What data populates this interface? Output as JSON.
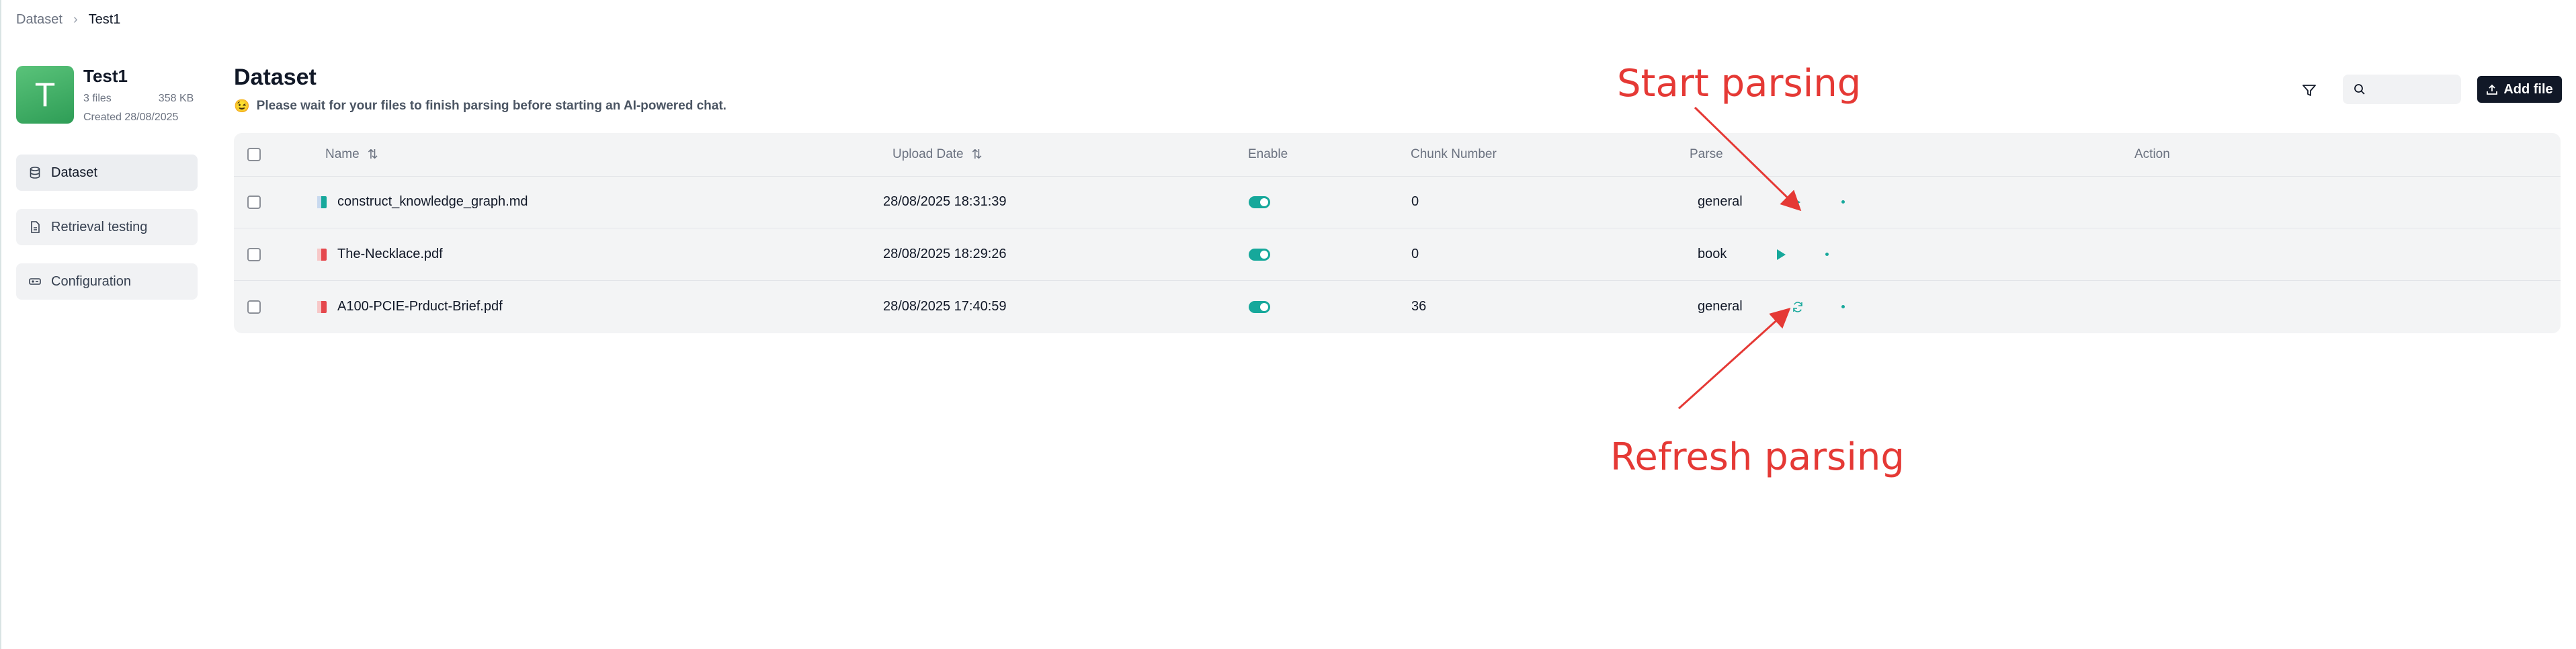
{
  "breadcrumb": {
    "parent": "Dataset",
    "current": "Test1"
  },
  "dataset": {
    "avatar_letter": "T",
    "name": "Test1",
    "files": "3 files",
    "size": "358 KB",
    "created": "Created 28/08/2025"
  },
  "sidebar": {
    "items": [
      {
        "label": "Dataset",
        "icon": "database-icon",
        "active": true
      },
      {
        "label": "Retrieval testing",
        "icon": "document-icon",
        "active": false
      },
      {
        "label": "Configuration",
        "icon": "settings-icon",
        "active": false
      }
    ]
  },
  "header": {
    "title": "Dataset",
    "notice_emoji": "😉",
    "notice": "Please wait for your files to finish parsing before starting an AI-powered chat."
  },
  "toolbar": {
    "search_placeholder": "",
    "add_file_label": "Add file"
  },
  "table": {
    "columns": {
      "name": "Name",
      "upload_date": "Upload Date",
      "enable": "Enable",
      "chunk_number": "Chunk Number",
      "parse": "Parse",
      "action": "Action"
    },
    "rows": [
      {
        "name": "construct_knowledge_graph.md",
        "file_type": "md",
        "upload_date": "28/08/2025 18:31:39",
        "enabled": true,
        "chunk_number": "0",
        "parse_method": "general",
        "parse_state": "start"
      },
      {
        "name": "The-Necklace.pdf",
        "file_type": "pdf",
        "upload_date": "28/08/2025 18:29:26",
        "enabled": true,
        "chunk_number": "0",
        "parse_method": "book",
        "parse_state": "start"
      },
      {
        "name": "A100-PCIE-Prduct-Brief.pdf",
        "file_type": "pdf",
        "upload_date": "28/08/2025 17:40:59",
        "enabled": true,
        "chunk_number": "36",
        "parse_method": "general",
        "parse_state": "refresh"
      }
    ]
  },
  "annotations": {
    "start_parsing": "Start parsing",
    "refresh_parsing": "Refresh parsing",
    "color": "#e53935"
  },
  "colors": {
    "accent": "#16a89b",
    "primary_button": "#111827",
    "avatar": "#3fae62"
  }
}
